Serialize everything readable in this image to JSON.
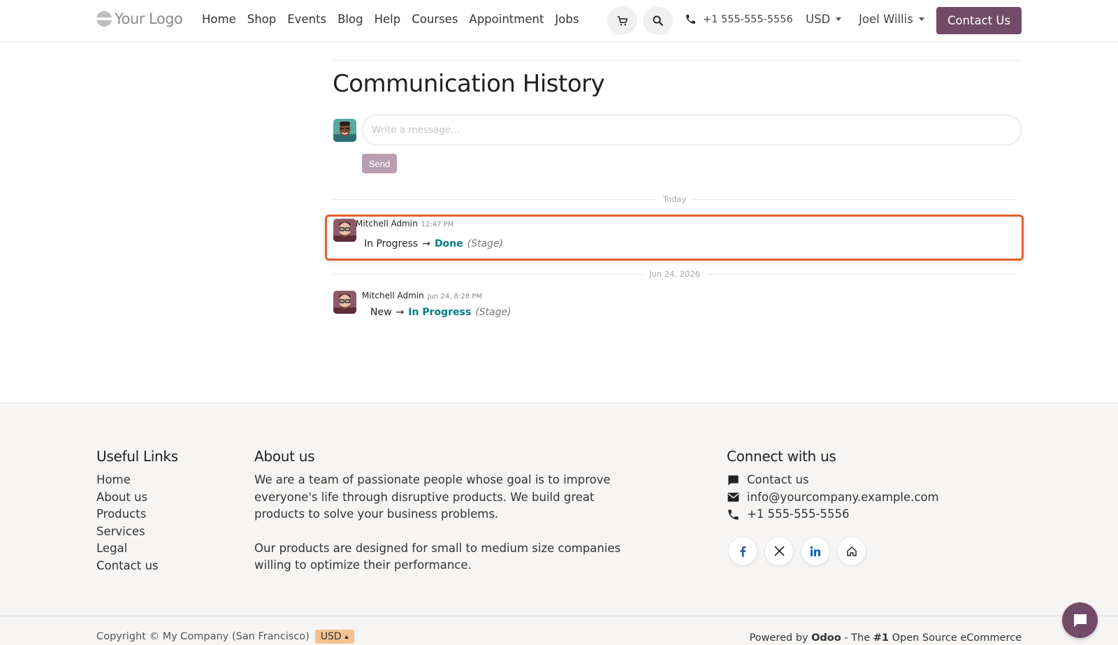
{
  "header": {
    "logo_text": "Your Logo",
    "nav": [
      "Home",
      "Shop",
      "Events",
      "Blog",
      "Help",
      "Courses",
      "Appointment",
      "Jobs"
    ],
    "phone": "+1 555-555-5556",
    "currency": "USD",
    "user": "Joel Willis",
    "contact_label": "Contact Us",
    "colors": {
      "brand": "#714b67"
    }
  },
  "main": {
    "title": "Communication History",
    "composer": {
      "placeholder": "Write a message...",
      "send_label": "Send"
    },
    "separators": [
      "Today",
      "Jun 24, 2026"
    ],
    "messages": [
      {
        "author": "Mitchell Admin",
        "time": "12:47 PM",
        "old_value": "In Progress",
        "arrow": "→",
        "new_value": "Done",
        "field": "(Stage)",
        "highlighted": true
      },
      {
        "author": "Mitchell Admin",
        "time": "Jun 24, 8:28 PM",
        "old_value": "New",
        "arrow": "→",
        "new_value": "In Progress",
        "field": "(Stage)",
        "highlighted": false
      }
    ],
    "colors": {
      "highlight_border": "#e4602f",
      "tracking_value": "#017e84"
    }
  },
  "footer": {
    "useful_links": {
      "title": "Useful Links",
      "items": [
        "Home",
        "About us",
        "Products",
        "Services",
        "Legal",
        "Contact us"
      ]
    },
    "about": {
      "title": "About us",
      "p1": "We are a team of passionate people whose goal is to improve everyone's life through disruptive products. We build great products to solve your business problems.",
      "p2": "Our products are designed for small to medium size companies willing to optimize their performance."
    },
    "connect": {
      "title": "Connect with us",
      "contact": "Contact us",
      "email": "info@yourcompany.example.com",
      "phone": "+1 555-555-5556",
      "socials": [
        "facebook-icon",
        "x-icon",
        "linkedin-icon",
        "home-icon"
      ]
    },
    "copyright": "Copyright © My Company (San Francisco)",
    "currency": "USD",
    "powered": {
      "prefix": "Powered by",
      "brand": "Odoo",
      "suffix": "- The",
      "rank": "#1",
      "tail": "Open Source eCommerce"
    }
  }
}
